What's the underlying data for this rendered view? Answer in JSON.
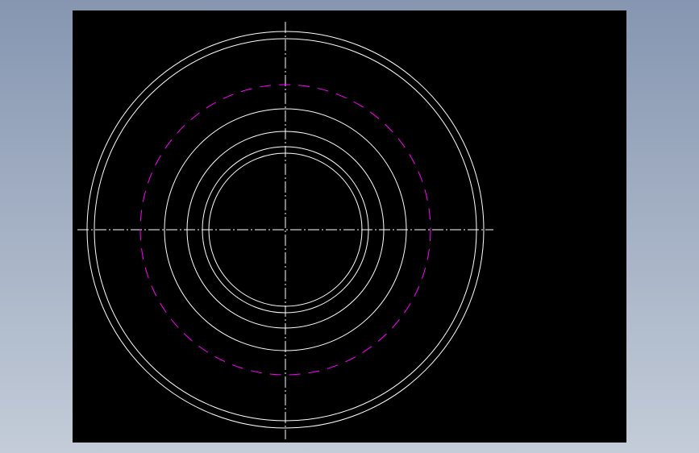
{
  "drawing": {
    "background_color": "#000000",
    "page_background_colors": [
      "#8696b1",
      "#c3ccd8"
    ],
    "line_color": "#ffffff",
    "hidden_line_color": "#ff00ff",
    "centerline_color": "#ffffff",
    "circles": [
      {
        "name": "outer-circle",
        "style": "solid"
      },
      {
        "name": "outer-inner-circle",
        "style": "solid"
      },
      {
        "name": "hidden-circle",
        "style": "dashed"
      },
      {
        "name": "middle-circle",
        "style": "solid"
      },
      {
        "name": "inner-circle-1",
        "style": "solid"
      },
      {
        "name": "inner-circle-2",
        "style": "solid"
      },
      {
        "name": "bore-circle",
        "style": "solid"
      }
    ]
  }
}
